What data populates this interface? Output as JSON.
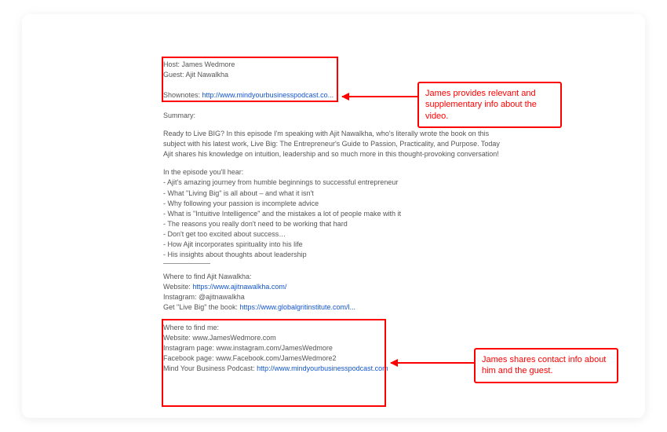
{
  "top_block": {
    "host_label": "Host: ",
    "host_name": "James Wedmore",
    "guest_label": "Guest: ",
    "guest_name": "Ajit Nawalkha",
    "shownotes_label": "Shownotes: ",
    "shownotes_link": "http://www.mindyourbusinesspodcast.co...",
    "summary_label": "Summary:"
  },
  "summary_paragraph": "Ready to Live BIG? In this episode I'm speaking with Ajit Nawalkha, who's literally wrote the book on this subject with his latest work, Live Big: The Entrepreneur's Guide to Passion, Practicality, and Purpose. Today Ajit shares his knowledge on intuition, leadership and so much more in this thought-provoking conversation!",
  "hear_list": {
    "intro": "In the episode you'll hear:",
    "items": [
      "- Ajit's amazing journey from humble beginnings to successful entrepreneur",
      "- What \"Living Big\" is all about – and what it isn't",
      "- Why following your passion is incomplete advice",
      "- What is \"Intuitive Intelligence\" and the mistakes a lot of people make with it",
      "- The reasons you really don't need to be working that hard",
      "-  Don't get too excited about success…",
      "- How Ajit incorporates spirituality into his life",
      "- His insights about thoughts about leadership"
    ]
  },
  "contact_block": {
    "find_guest_label": "Where to find Ajit Nawalkha:",
    "guest_website_label": "Website: ",
    "guest_website_link": "https://www.ajitnawalkha.com/",
    "guest_instagram_label": "Instagram: ",
    "guest_instagram_handle": "@ajitnawalkha",
    "book_label": "Get \"Live Big\" the book: ",
    "book_link": "https://www.globalgritinstitute.com/l...",
    "find_me_label": "Where to find me:",
    "me_website_label": "Website: ",
    "me_website_value": "www.JamesWedmore.com",
    "me_instagram_label": "Instagram page: ",
    "me_instagram_value": "www.instagram.com/JamesWedmore",
    "me_facebook_label": "Facebook page: ",
    "me_facebook_value": "www.Facebook.com/JamesWedmore2",
    "me_podcast_label": "Mind Your Business Podcast: ",
    "me_podcast_link": "http://www.mindyourbusinesspodcast.com"
  },
  "callouts": {
    "top": "James provides relevant and supplementary info about the video.",
    "bottom": "James shares contact info about him and the guest."
  }
}
